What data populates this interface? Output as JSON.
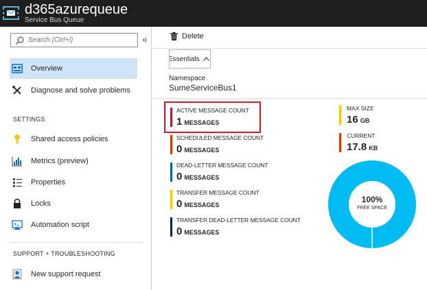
{
  "window": {
    "title": "d365azurequeue",
    "subtitle": "Service Bus Queue",
    "icon": "service-bus-queue-icon"
  },
  "sidebar": {
    "search_placeholder": "Search (Ctrl+/)",
    "collapse_label": "«",
    "items": [
      {
        "label": "Overview",
        "icon": "overview-icon",
        "selected": true
      },
      {
        "label": "Diagnose and solve problems",
        "icon": "wrench-icon"
      },
      {
        "label": "Shared access policies",
        "icon": "key-icon"
      },
      {
        "label": "Metrics (preview)",
        "icon": "metrics-icon"
      },
      {
        "label": "Properties",
        "icon": "properties-icon"
      },
      {
        "label": "Locks",
        "icon": "lock-icon"
      },
      {
        "label": "Automation script",
        "icon": "automation-icon"
      },
      {
        "label": "New support request",
        "icon": "support-icon"
      }
    ],
    "sections": {
      "settings": "SETTINGS",
      "support": "SUPPORT + TROUBLESHOOTING"
    }
  },
  "toolbar": {
    "delete_label": "Delete"
  },
  "essentials": {
    "label": "Essentials",
    "namespace_label": "Namespace",
    "namespace_value": "SumeServiceBus1"
  },
  "metrics": [
    {
      "label": "ACTIVE MESSAGE COUNT",
      "value": "1",
      "unit": "MESSAGES",
      "color": "#a4262c"
    },
    {
      "label": "SCHEDULED MESSAGE COUNT",
      "value": "0",
      "unit": "MESSAGES",
      "color": "#d83b01"
    },
    {
      "label": "DEAD-LETTER MESSAGE COUNT",
      "value": "0",
      "unit": "MESSAGES",
      "color": "#0063b1"
    },
    {
      "label": "TRANSFER MESSAGE COUNT",
      "value": "0",
      "unit": "MESSAGES",
      "color": "#f2c811"
    },
    {
      "label": "TRANSFER DEAD-LETTER MESSAGE COUNT",
      "value": "0",
      "unit": "MESSAGES",
      "color": "#002050"
    }
  ],
  "size": {
    "max_label": "MAX SIZE",
    "max_value": "16",
    "max_unit": "GB",
    "max_color": "#f2c811",
    "current_label": "CURRENT",
    "current_value": "17.8",
    "current_unit": "KB",
    "current_color": "#d83b01"
  },
  "free_space": {
    "percent_text": "100%",
    "label": "FREE SPACE",
    "fraction": 1.0,
    "color": "#00bcf2"
  }
}
